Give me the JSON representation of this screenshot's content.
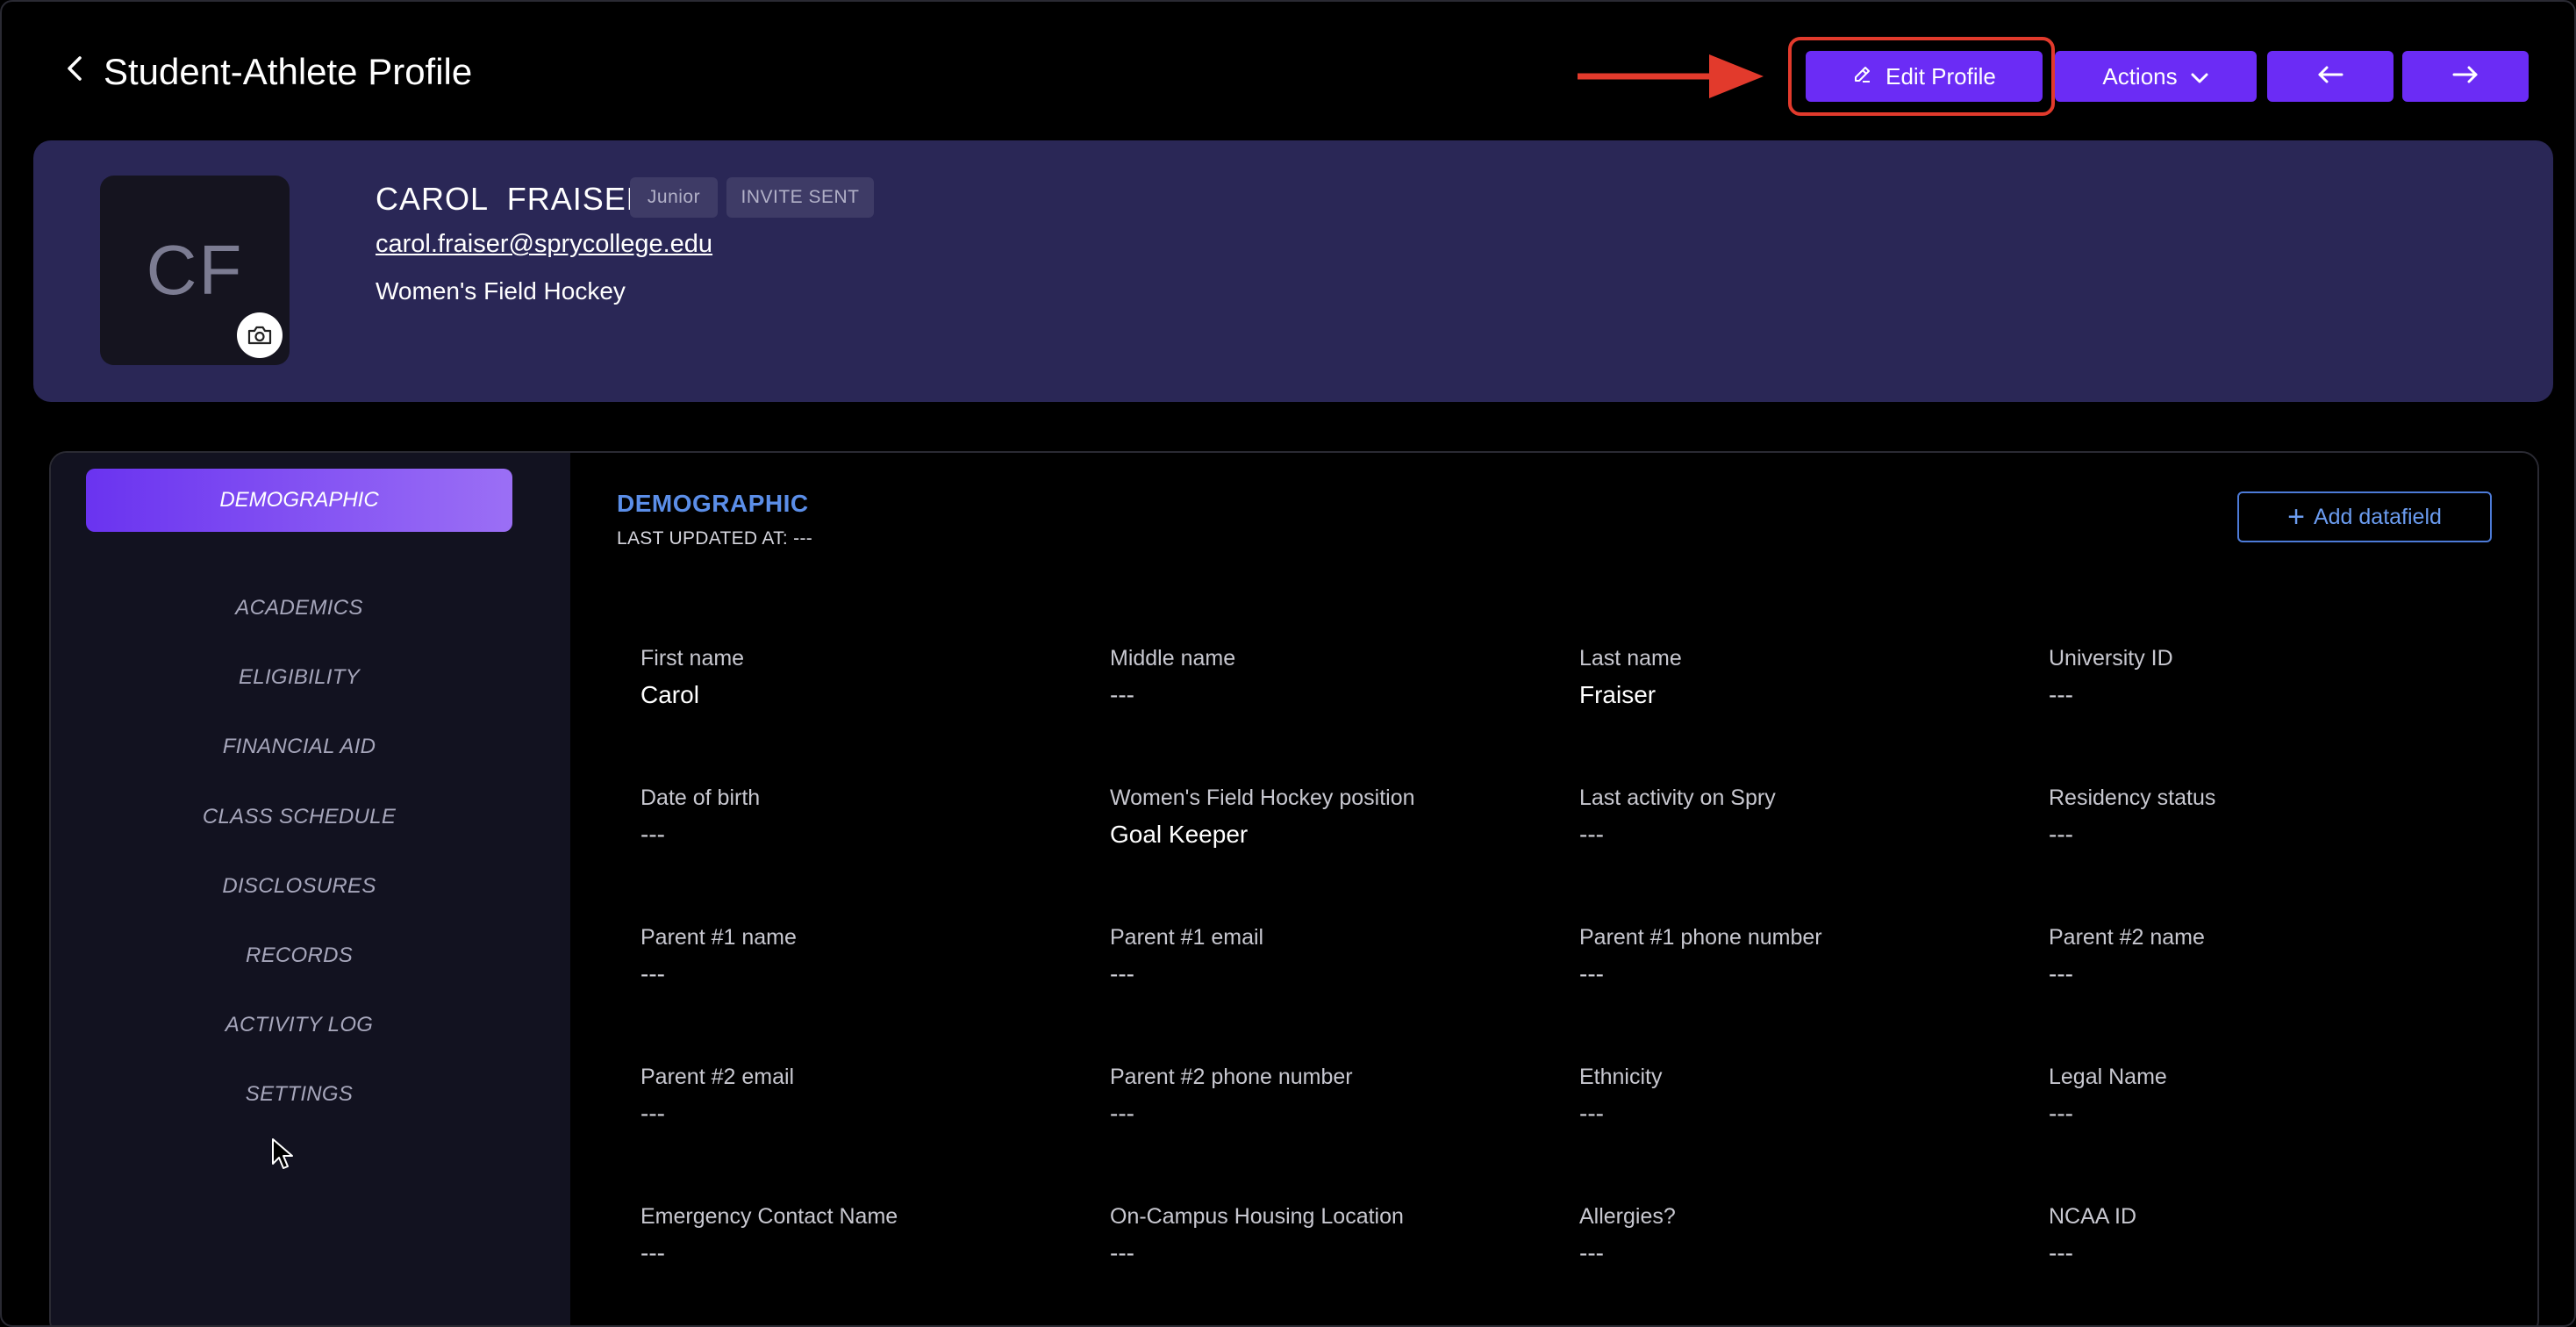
{
  "header": {
    "title": "Student-Athlete Profile",
    "edit_label": "Edit Profile",
    "actions_label": "Actions"
  },
  "profile": {
    "initials": "CF",
    "name": "CAROL  FRAISER",
    "class_badge": "Junior",
    "status_badge": "INVITE SENT",
    "email": "carol.fraiser@sprycollege.edu",
    "sport": "Women's Field Hockey"
  },
  "sidebar": {
    "items": [
      {
        "label": "DEMOGRAPHIC",
        "active": true
      },
      {
        "label": "ACADEMICS"
      },
      {
        "label": "ELIGIBILITY"
      },
      {
        "label": "FINANCIAL AID"
      },
      {
        "label": "CLASS SCHEDULE"
      },
      {
        "label": "DISCLOSURES"
      },
      {
        "label": "RECORDS"
      },
      {
        "label": "ACTIVITY LOG"
      },
      {
        "label": "SETTINGS"
      }
    ]
  },
  "section": {
    "title": "DEMOGRAPHIC",
    "last_updated": "LAST UPDATED AT: ---",
    "add_label": "Add datafield",
    "add_symbol": "+"
  },
  "fields": [
    {
      "label": "First name",
      "value": "Carol"
    },
    {
      "label": "Middle name",
      "value": "---"
    },
    {
      "label": "Last name",
      "value": "Fraiser"
    },
    {
      "label": "University ID",
      "value": "---"
    },
    {
      "label": "Date of birth",
      "value": "---"
    },
    {
      "label": "Women's Field Hockey position",
      "value": "Goal Keeper"
    },
    {
      "label": "Last activity on Spry",
      "value": "---"
    },
    {
      "label": "Residency status",
      "value": "---"
    },
    {
      "label": "Parent #1 name",
      "value": "---"
    },
    {
      "label": "Parent #1 email",
      "value": "---"
    },
    {
      "label": "Parent #1 phone number",
      "value": "---"
    },
    {
      "label": "Parent #2 name",
      "value": "---"
    },
    {
      "label": "Parent #2 email",
      "value": "---"
    },
    {
      "label": "Parent #2 phone number",
      "value": "---"
    },
    {
      "label": "Ethnicity",
      "value": "---"
    },
    {
      "label": "Legal Name",
      "value": "---"
    },
    {
      "label": "Emergency Contact Name",
      "value": "---"
    },
    {
      "label": "On-Campus Housing Location",
      "value": "---"
    },
    {
      "label": "Allergies?",
      "value": "---"
    },
    {
      "label": "NCAA ID",
      "value": "---"
    }
  ],
  "colors": {
    "accent": "#6b2cf5",
    "banner": "#2a2756",
    "link_blue": "#5b8ee8",
    "annotation_red": "#e23a2c"
  }
}
